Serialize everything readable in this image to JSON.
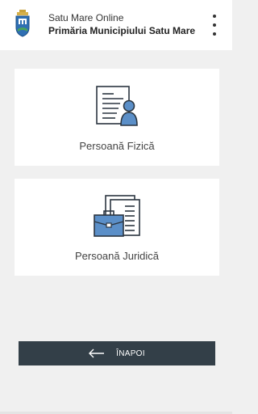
{
  "header": {
    "subtitle": "Satu Mare Online",
    "title": "Primăria Municipiului Satu Mare",
    "crest_icon": "city-crest",
    "menu_icon": "kebab-menu-icon"
  },
  "options": [
    {
      "label": "Persoană Fizică",
      "icon": "person-document-icon"
    },
    {
      "label": "Persoană Juridică",
      "icon": "briefcase-document-icon"
    }
  ],
  "back_button": {
    "label": "ÎNAPOI",
    "icon": "arrow-left-icon"
  },
  "colors": {
    "accent_blue": "#5b8fc8",
    "dark_button": "#333f48",
    "background": "#f0f0f0"
  }
}
